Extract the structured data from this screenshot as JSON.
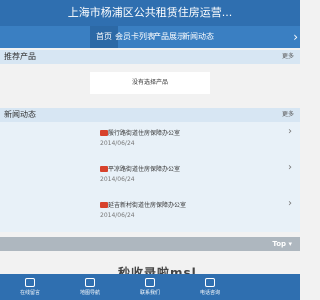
{
  "header": {
    "title": "上海市杨浦区公共租赁住房运营..."
  },
  "nav": {
    "items": [
      "首页",
      "会员卡列表",
      "产品展示",
      "新闻动态"
    ]
  },
  "recommended": {
    "title": "推荐产品",
    "more": "更多",
    "empty": "没有选择产品"
  },
  "news": {
    "title": "新闻动态",
    "more": "更多",
    "items": [
      {
        "title": "殷行路街道住房保障办公室",
        "date": "2014/06/24"
      },
      {
        "title": "平凉路街道住房保障办公室",
        "date": "2014/06/24"
      },
      {
        "title": "延吉新村街道住房保障办公室",
        "date": "2014/06/24"
      }
    ]
  },
  "top_button": "Top",
  "watermark": "秒收录啦msl",
  "bottom_bar": {
    "tabs": [
      "在线留言",
      "地图导航",
      "联系我们",
      "电话咨询"
    ]
  }
}
